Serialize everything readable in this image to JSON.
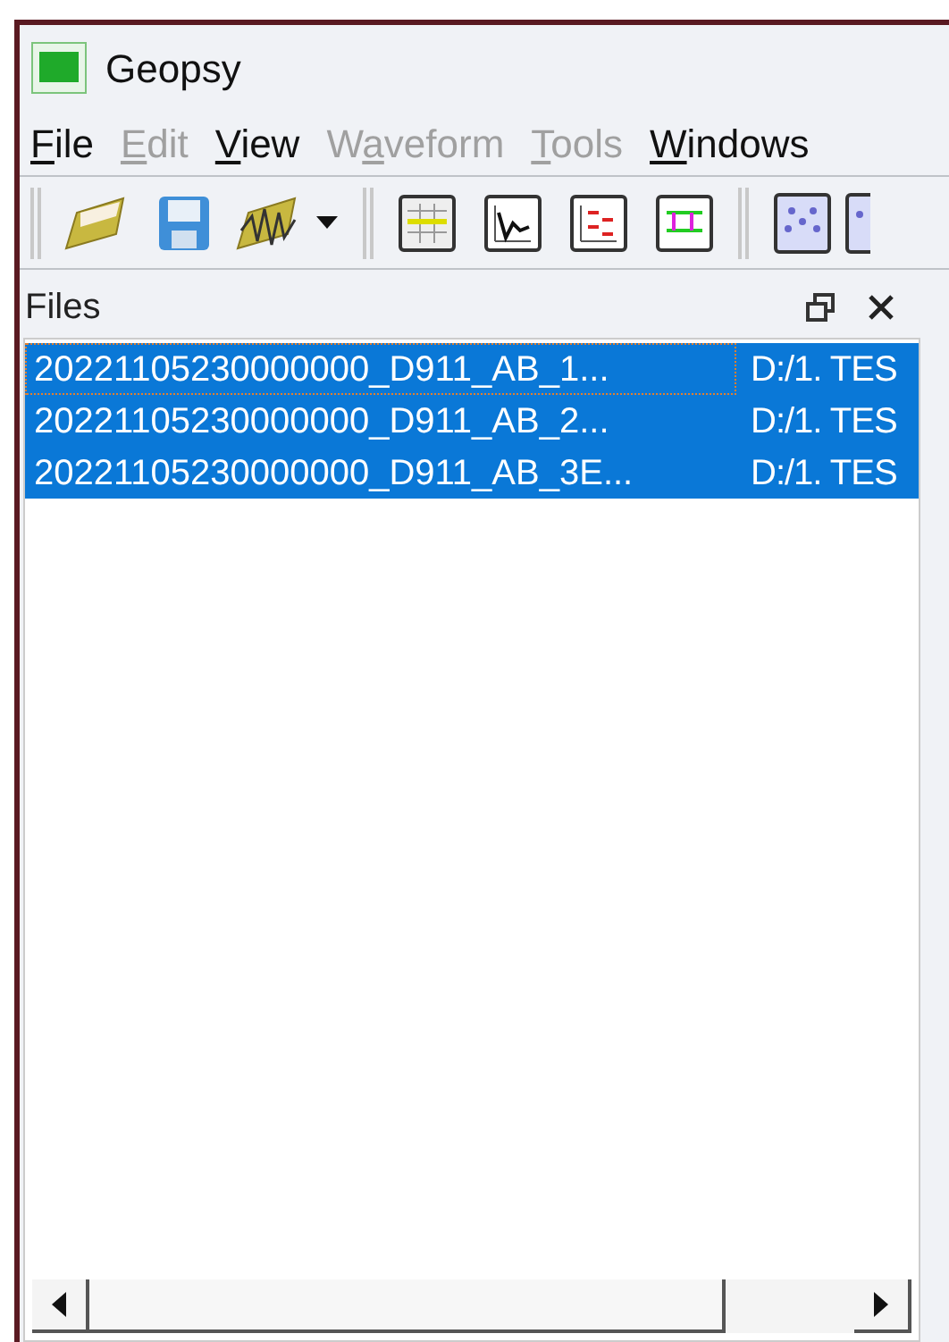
{
  "window": {
    "title": "Geopsy"
  },
  "menu": [
    {
      "mnemonic": "F",
      "label_rest": "ile",
      "disabled": false
    },
    {
      "mnemonic": "E",
      "label_rest": "dit",
      "disabled": true
    },
    {
      "mnemonic": "V",
      "label_rest": "iew",
      "disabled": false
    },
    {
      "label_start": "W",
      "mnemonic": "a",
      "label_rest": "veform",
      "disabled": true
    },
    {
      "mnemonic": "T",
      "label_rest": "ools",
      "disabled": true
    },
    {
      "mnemonic": "W",
      "label_rest": "indows",
      "disabled": false
    }
  ],
  "files_panel": {
    "title": "Files",
    "rows": [
      {
        "name": "20221105230000000_D911_AB_1...",
        "path": "D:/1. TES",
        "selected": true,
        "focused": true
      },
      {
        "name": "20221105230000000_D911_AB_2...",
        "path": "D:/1. TES",
        "selected": true,
        "focused": false
      },
      {
        "name": "20221105230000000_D911_AB_3E...",
        "path": "D:/1. TES",
        "selected": true,
        "focused": false
      }
    ]
  }
}
